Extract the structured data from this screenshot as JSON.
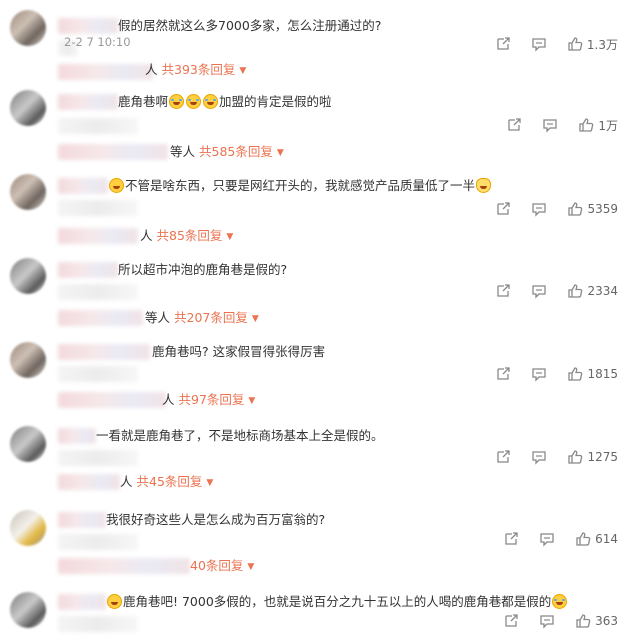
{
  "comments": [
    {
      "text": "假的居然就这么多7000多家，怎么注册通过的?",
      "time": "2-2 7 10:10",
      "replies_suffix": "人",
      "replies_count": "共393条回复",
      "likes": "1.3万"
    },
    {
      "text": "鹿角巷啊",
      "text_after": "加盟的肯定是假的啦",
      "replies_suffix": "等人",
      "replies_count": "共585条回复",
      "likes": "1万"
    },
    {
      "text": "不管是啥东西，只要是网红开头的，我就感觉产品质量低了一半",
      "replies_suffix": "人",
      "replies_count": "共85条回复",
      "likes": "5359"
    },
    {
      "text": "所以超市冲泡的鹿角巷是假的?",
      "replies_suffix": "等人",
      "replies_count": "共207条回复",
      "likes": "2334"
    },
    {
      "text": "鹿角巷吗? 这家假冒得张得厉害",
      "replies_suffix": "人",
      "replies_count": "共97条回复",
      "likes": "1815"
    },
    {
      "text": "一看就是鹿角巷了，不是地标商场基本上全是假的。",
      "replies_suffix": "人",
      "replies_count": "共45条回复",
      "likes": "1275"
    },
    {
      "text": "我很好奇这些人是怎么成为百万富翁的?",
      "replies_suffix": "",
      "replies_count": "40条回复",
      "likes": "614"
    },
    {
      "text": "鹿角巷吧! 7000多假的，也就是说百分之九十五以上的人喝的鹿角巷都是假的",
      "replies_suffix": "",
      "replies_count": "",
      "likes": "363"
    }
  ],
  "icons": {
    "share": "share-icon",
    "comment": "comment-icon",
    "like": "thumbs-up-icon",
    "expand": "caret-down-icon"
  },
  "colors": {
    "reply_count": "#eb7350",
    "meta": "#999999"
  }
}
